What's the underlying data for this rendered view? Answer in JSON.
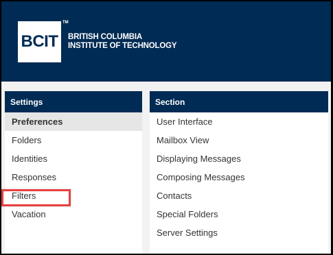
{
  "colors": {
    "brand_navy": "#002B54",
    "highlight_red": "#E8413F",
    "content_bg": "#f2f2f2",
    "active_row_bg": "#e6e6e6"
  },
  "banner": {
    "logo_text": "BCIT",
    "trademark": "TM",
    "institution_line1": "BRITISH COLUMBIA",
    "institution_line2": "INSTITUTE OF TECHNOLOGY"
  },
  "settings": {
    "header": "Settings",
    "items": [
      {
        "label": "Preferences",
        "active": true
      },
      {
        "label": "Folders"
      },
      {
        "label": "Identities"
      },
      {
        "label": "Responses"
      },
      {
        "label": "Filters",
        "highlighted": true
      },
      {
        "label": "Vacation"
      }
    ]
  },
  "section": {
    "header": "Section",
    "items": [
      {
        "label": "User Interface"
      },
      {
        "label": "Mailbox View"
      },
      {
        "label": "Displaying Messages"
      },
      {
        "label": "Composing Messages"
      },
      {
        "label": "Contacts"
      },
      {
        "label": "Special Folders"
      },
      {
        "label": "Server Settings"
      }
    ]
  }
}
